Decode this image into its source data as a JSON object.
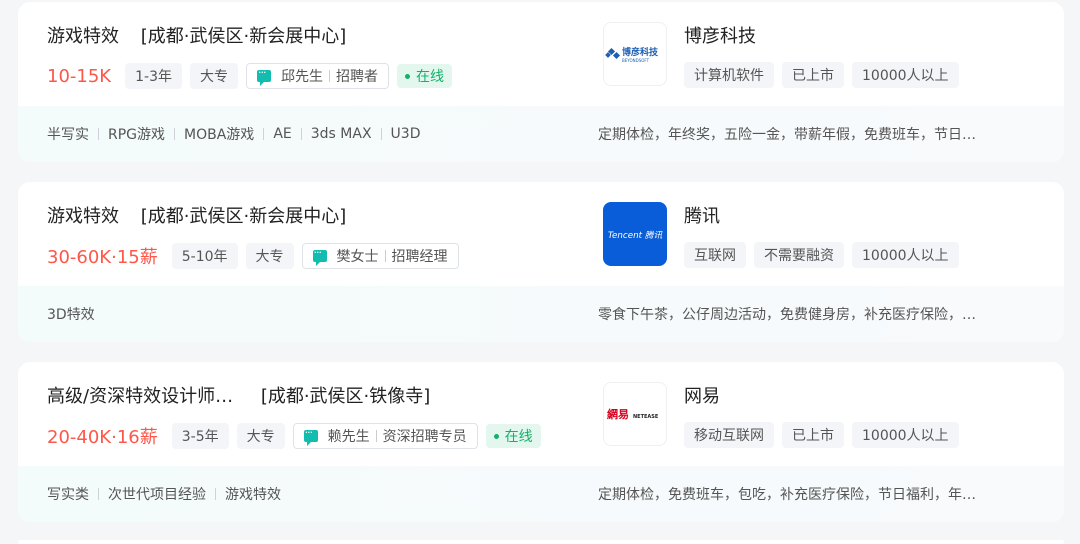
{
  "jobs": [
    {
      "title": "游戏特效",
      "location": "[成都·武侯区·新会展中心]",
      "salary": "10-15K",
      "experience": "1-3年",
      "education": "大专",
      "recruiter_name": "邱先生",
      "recruiter_role": "招聘者",
      "online": "在线",
      "company": "博彦科技",
      "company_tags": [
        "计算机软件",
        "已上市",
        "10000人以上"
      ],
      "skills": [
        "半写实",
        "RPG游戏",
        "MOBA游戏",
        "AE",
        "3ds MAX",
        "U3D"
      ],
      "welfare": "定期体检，年终奖，五险一金，带薪年假，免费班车，节日…",
      "logo_text": "博彦科技",
      "logo_subtext": "BEYONDSOFT"
    },
    {
      "title": "游戏特效",
      "location": "[成都·武侯区·新会展中心]",
      "salary": "30-60K·15薪",
      "experience": "5-10年",
      "education": "大专",
      "recruiter_name": "樊女士",
      "recruiter_role": "招聘经理",
      "company": "腾讯",
      "company_tags": [
        "互联网",
        "不需要融资",
        "10000人以上"
      ],
      "skills": [
        "3D特效"
      ],
      "welfare": "零食下午茶，公仔周边活动，免费健身房，补充医疗保险，…",
      "logo_text": "Tencent 腾讯"
    },
    {
      "title": "高级/资深特效设计师…",
      "location": "[成都·武侯区·铁像寺]",
      "salary": "20-40K·16薪",
      "experience": "3-5年",
      "education": "大专",
      "recruiter_name": "赖先生",
      "recruiter_role": "资深招聘专员",
      "online": "在线",
      "company": "网易",
      "company_tags": [
        "移动互联网",
        "已上市",
        "10000人以上"
      ],
      "skills": [
        "写实类",
        "次世代项目经验",
        "游戏特效"
      ],
      "welfare": "定期体检，免费班车，包吃，补充医疗保险，节日福利，年…",
      "logo_text": "網易",
      "logo_subtext": "NETEASE"
    }
  ],
  "colors": {
    "salary": "#fe574a",
    "online": "#16b06a",
    "chat_icon": "#12bdb0",
    "tencent_blue": "#0a5dd8",
    "netease_red": "#d6001c",
    "beyondsoft_blue": "#1e5fb4"
  }
}
